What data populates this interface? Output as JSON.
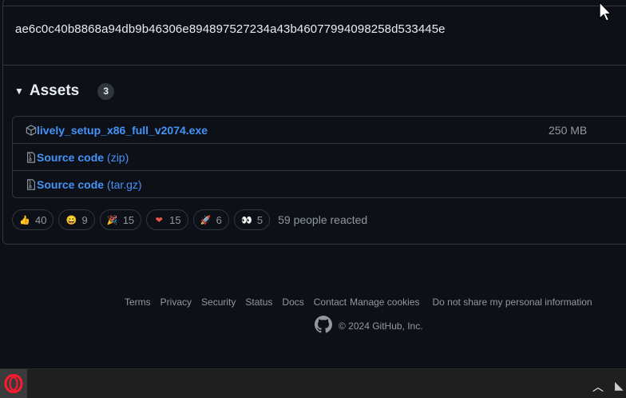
{
  "release": {
    "hash": "ae6c0c40b8868a94db9b46306e894897527234a43b46077994098258d533445e"
  },
  "assets": {
    "title": "Assets",
    "count": "3",
    "items": [
      {
        "name": "lively_setup_x86_full_v2074.exe",
        "ext": "",
        "size": "250 MB",
        "icon": "package-icon"
      },
      {
        "name": "Source code",
        "ext": "(zip)",
        "size": "",
        "icon": "file-zip-icon"
      },
      {
        "name": "Source code",
        "ext": "(tar.gz)",
        "size": "",
        "icon": "file-zip-icon"
      }
    ]
  },
  "reactions": {
    "items": [
      {
        "emoji": "👍",
        "count": "40",
        "name": "thumbs-up"
      },
      {
        "emoji": "😄",
        "count": "9",
        "name": "laugh"
      },
      {
        "emoji": "🎉",
        "count": "15",
        "name": "hooray"
      },
      {
        "emoji": "❤",
        "count": "15",
        "name": "heart"
      },
      {
        "emoji": "🚀",
        "count": "6",
        "name": "rocket"
      },
      {
        "emoji": "👀",
        "count": "5",
        "name": "eyes"
      }
    ],
    "summary": "59 people reacted"
  },
  "footer": {
    "links": [
      "Terms",
      "Privacy",
      "Security",
      "Status",
      "Docs",
      "Contact",
      "Manage cookies",
      "Do not share my personal information"
    ],
    "copyright": "© 2024 GitHub, Inc."
  },
  "colors": {
    "background": "#0d1117",
    "border": "#30363d",
    "link": "#4493f8",
    "muted": "#9198a1"
  }
}
